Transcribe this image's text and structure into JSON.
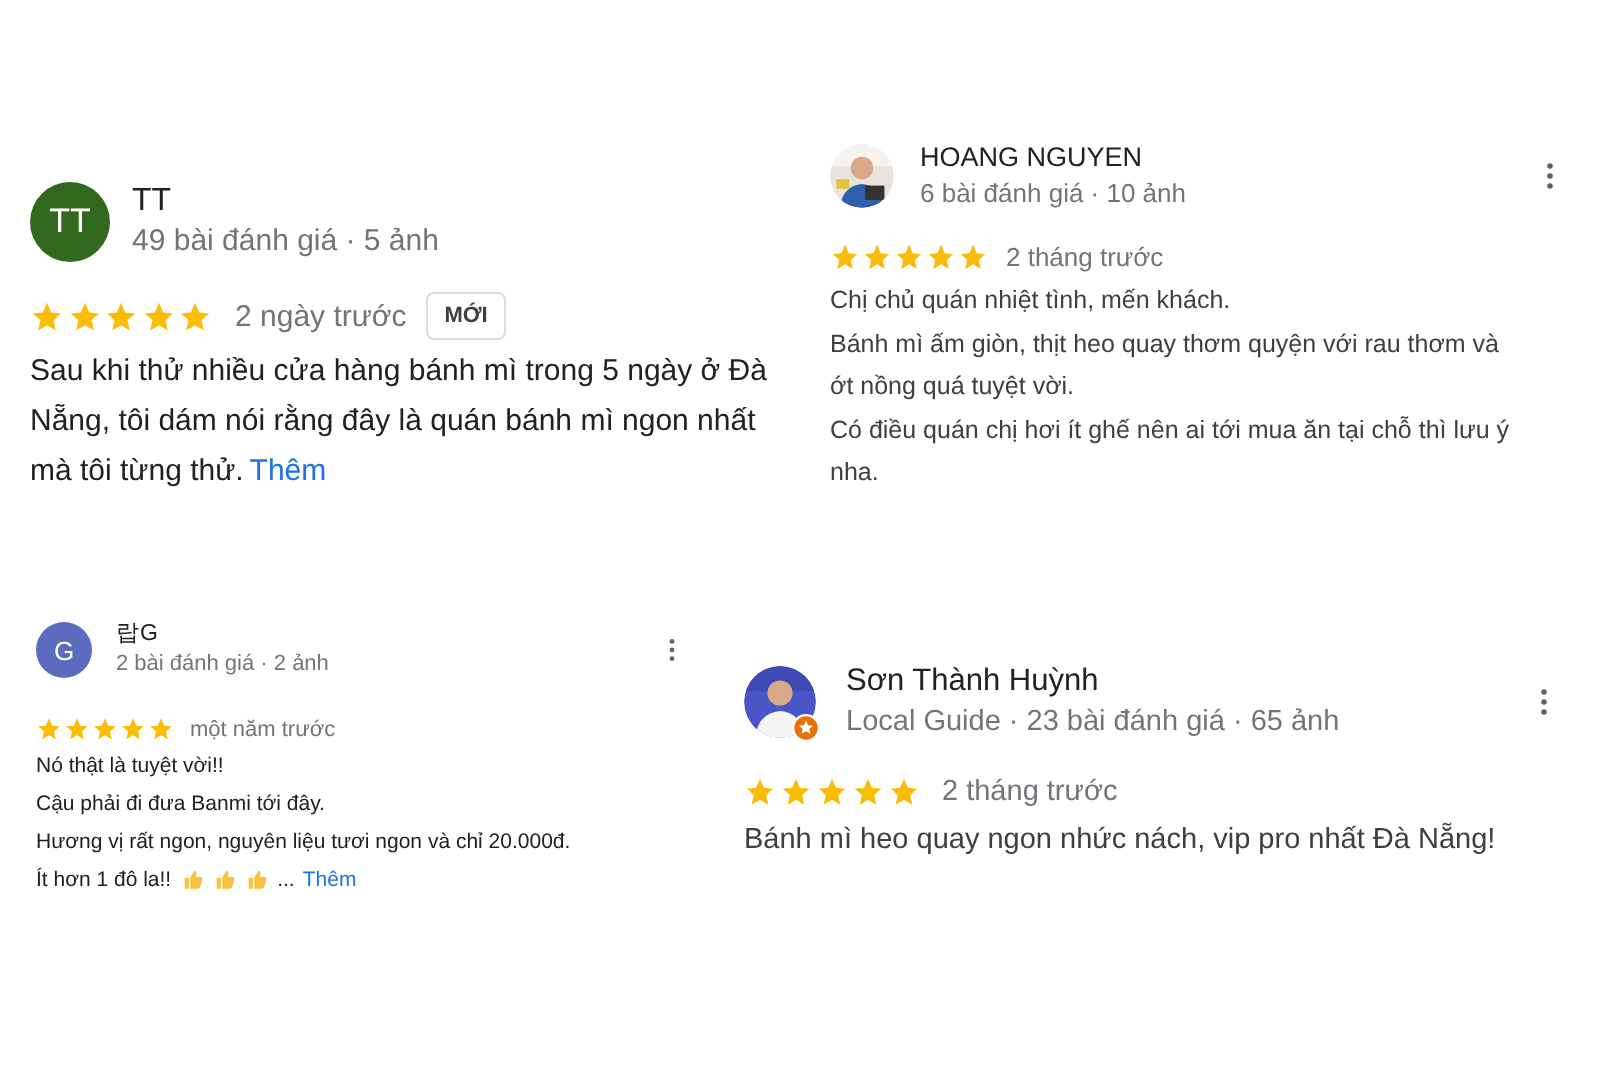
{
  "reviews": [
    {
      "name": "TT",
      "avatar": {
        "kind": "initials",
        "text": "TT",
        "color": "#33691e"
      },
      "local_guide_badge": false,
      "meta": "49 bài đánh giá · 5 ảnh",
      "menu": false,
      "stars": 5,
      "time": "2 ngày trước",
      "badge": "MỚI",
      "paragraphs": [
        "Sau khi thử nhiều cửa hàng bánh mì trong 5 ngày ở Đà Nẵng, tôi dám nói rằng đây là quán bánh mì ngon nhất mà tôi từng thử."
      ],
      "more": "Thêm"
    },
    {
      "name": "HOANG NGUYEN",
      "avatar": {
        "kind": "picture"
      },
      "local_guide_badge": false,
      "meta": "6 bài đánh giá · 10 ảnh",
      "menu": true,
      "stars": 5,
      "time": "2 tháng trước",
      "paragraphs": [
        "Chị chủ quán nhiệt tình, mến khách.",
        "Bánh mì ấm giòn, thịt heo quay thơm quyện với rau thơm và ớt nồng quá tuyệt vời.",
        "Có điều quán chị hơi ít ghế nên ai tới mua ăn tại chỗ thì lưu ý nha."
      ]
    },
    {
      "name": "랍G",
      "avatar": {
        "kind": "initials",
        "text": "G",
        "color": "#5c6bc0"
      },
      "local_guide_badge": false,
      "meta": "2 bài đánh giá · 2 ảnh",
      "menu": true,
      "stars": 5,
      "time": "một năm trước",
      "paragraphs": [
        "Nó thật là tuyệt vời!!",
        "Cậu phải đi đưa Banmi tới đây.",
        "Hương vị rất ngon, nguyên liệu tươi ngon và chỉ 20.000đ.",
        "Ít hơn 1 đô la!!"
      ],
      "trailing_icons": [
        {
          "kind": "thumbs-up"
        },
        {
          "kind": "thumbs-up"
        },
        {
          "kind": "thumbs-up"
        }
      ],
      "ellipsis": "...",
      "more": "Thêm"
    },
    {
      "name": "Sơn Thành Huỳnh",
      "avatar": {
        "kind": "picture"
      },
      "local_guide_badge": true,
      "meta": "Local Guide · 23 bài đánh giá · 65 ảnh",
      "menu": true,
      "stars": 5,
      "time": "2 tháng trước",
      "paragraphs": [
        "Bánh mì heo quay ngon nhức nách, vip pro nhất Đà Nẵng!"
      ]
    }
  ]
}
